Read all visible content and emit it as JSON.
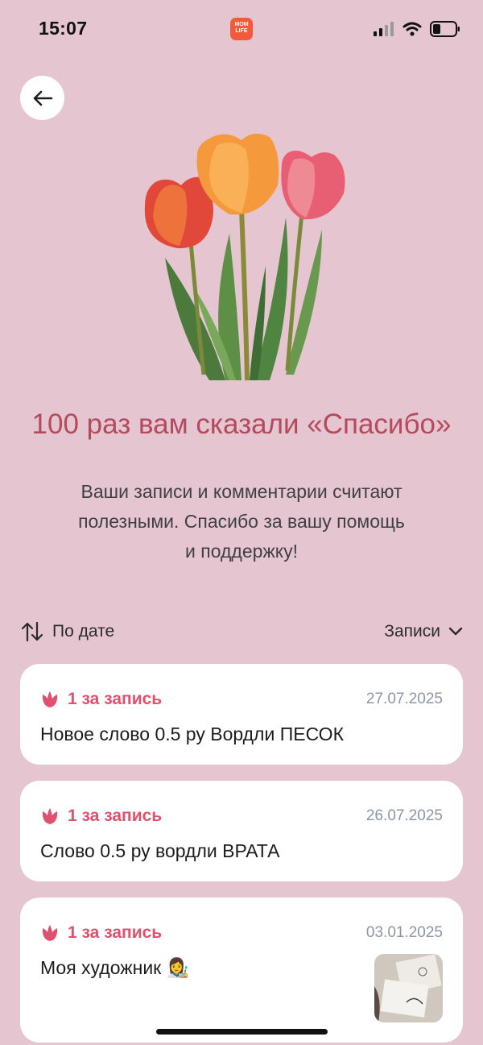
{
  "status": {
    "time": "15:07",
    "app_badge_line1": "MOM",
    "app_badge_line2": "LIFE"
  },
  "header": {
    "back_icon": "arrow-left-icon"
  },
  "hero": {
    "image": "tulips-illustration"
  },
  "title": "100 раз вам сказали «Спасибо»",
  "subtitle_lines": [
    "Ваши записи и комментарии считают",
    "полезными. Спасибо за вашу помощь",
    "и поддержку!"
  ],
  "sort": {
    "label": "По дате",
    "icon": "sort-arrows-icon"
  },
  "filter": {
    "label": "Записи",
    "icon": "chevron-down-icon"
  },
  "entries": [
    {
      "badge": "1 за запись",
      "date": "27.07.2025",
      "text": "Новое слово 0.5 ру Вордли ПЕСОК"
    },
    {
      "badge": "1 за запись",
      "date": "26.07.2025",
      "text": "Слово 0.5 ру вордли ВРАТА"
    },
    {
      "badge": "1 за запись",
      "date": "03.01.2025",
      "text": "Моя художник 👩‍🎨"
    }
  ],
  "colors": {
    "background": "#e5c5cf",
    "accent": "#e0506f",
    "title": "#b34a5e"
  }
}
